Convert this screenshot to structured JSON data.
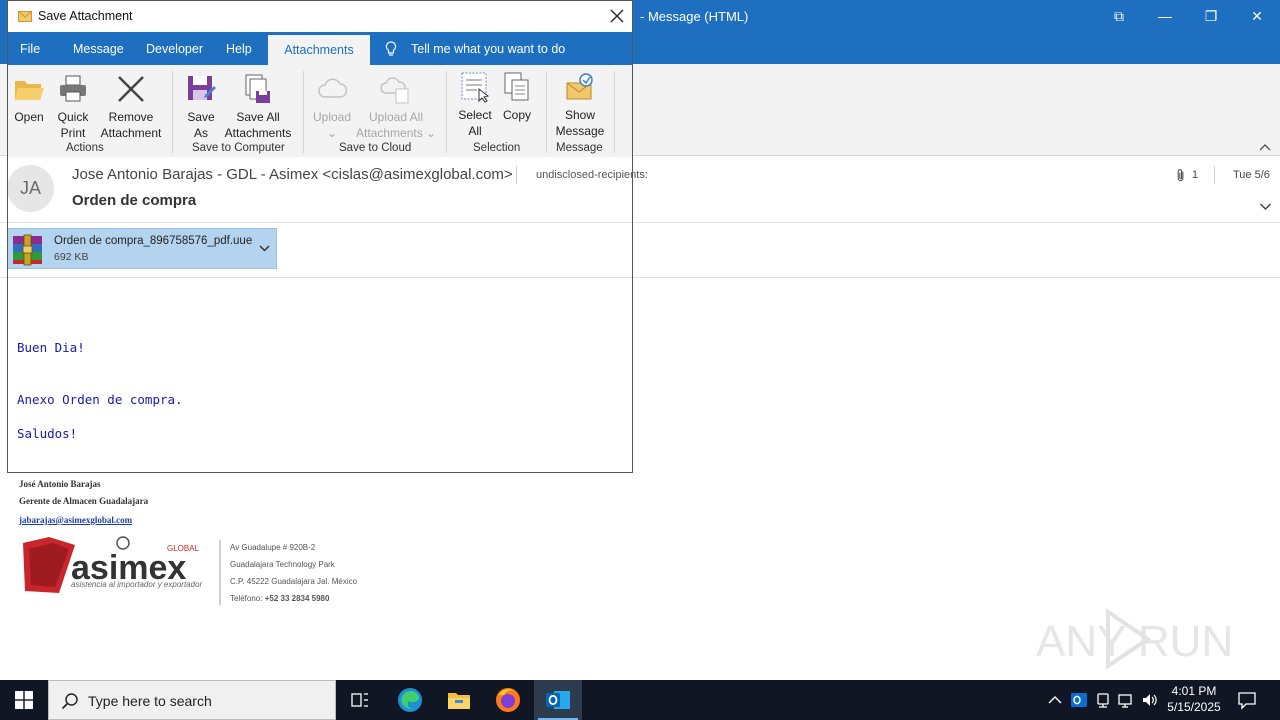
{
  "outlook": {
    "window_title": "- Message (HTML)",
    "restore_label": "⧉",
    "minimize_label": "—",
    "maximize_label": "❐",
    "close_label": "✕"
  },
  "message": {
    "avatar_initials": "JA",
    "sender": "Jose Antonio Barajas - GDL - Asimex <cislas@asimexglobal.com>",
    "recipients": "undisclosed-recipients:",
    "subject": "Orden de compra",
    "attachment_count": "1",
    "date": "Tue 5/6",
    "attachment": {
      "name": "Orden de compra_896758576_pdf.uue",
      "size": "692 KB"
    },
    "body": {
      "greeting": "Buen Dia!",
      "line1": "Anexo Orden de compra.",
      "closing": "Saludos!"
    },
    "signature": {
      "name": "José Antonio Barajas",
      "role": "Gerente de Almacen Guadalajara",
      "email": "jabarajas@asimexglobal.com",
      "logo_text": "asimex",
      "logo_tag": "GLOBAL",
      "logo_slogan": "asistencia al importador y exportador",
      "address1": "Av Guadalupe # 920B-2",
      "address2": "Guadalajara Technology Park",
      "address3": "C.P. 45222 Guadalajara Jal. México",
      "phone_label": "Teléfono:",
      "phone": "+52 33 2834 5980"
    }
  },
  "dialog": {
    "title": "Save Attachment",
    "tabs": [
      "File",
      "Message",
      "Developer",
      "Help"
    ],
    "active_tab": "Attachments",
    "tell_me": "Tell me what you want to do",
    "ribbon": {
      "open": "Open",
      "quick_print_1": "Quick",
      "quick_print_2": "Print",
      "remove_1": "Remove",
      "remove_2": "Attachment",
      "group_actions": "Actions",
      "save_as_1": "Save",
      "save_as_2": "As",
      "save_all_1": "Save All",
      "save_all_2": "Attachments",
      "group_save_computer": "Save to Computer",
      "upload_1": "Upload",
      "upload_all_1": "Upload All",
      "upload_all_2": "Attachments",
      "group_save_cloud": "Save to Cloud",
      "select_all_1": "Select",
      "select_all_2": "All",
      "copy": "Copy",
      "group_selection": "Selection",
      "show_message_1": "Show",
      "show_message_2": "Message",
      "group_message": "Message"
    }
  },
  "taskbar": {
    "search_placeholder": "Type here to search",
    "time": "4:01 PM",
    "date": "5/15/2025"
  },
  "watermark": "ANY RUN",
  "colors": {
    "outlook_blue": "#1e6fbf",
    "body_text": "#1a1aa8",
    "attachment_chip": "#b3d3ee",
    "taskbar": "#101623"
  }
}
